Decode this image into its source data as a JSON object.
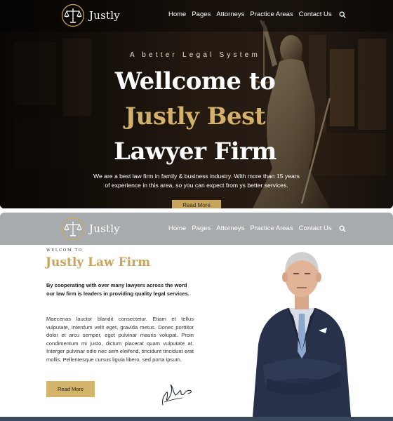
{
  "brand": {
    "name": "Justly",
    "accent": "#c9a55c",
    "logo_icon": "scales-of-justice-icon"
  },
  "nav": {
    "items": [
      "Home",
      "Pages",
      "Attorneys",
      "Practice Areas",
      "Contact Us"
    ],
    "search_icon": "search-icon"
  },
  "hero": {
    "tagline": "A better Legal System",
    "title_line1": "Wellcome to",
    "title_line2": "Justly Best",
    "title_line3": "Lawyer Firm",
    "description": "We are a best law firm in family & business industry. With more than 15 years of experience in this area, so you can expect from ys better services.",
    "button_label": "Read More",
    "title_line2_color": "#d4b16a"
  },
  "about": {
    "eyebrow": "WELCOM TO",
    "title": "Justly Law Firm",
    "lead": "By cooperating with over many lawyers across the word our law firm is leaders in providing quality legal services.",
    "body": "Maecenas lauctor blandit consectetur. Etiam et tellus vulputate, interdum velit eget, gravida metus. Donec porttitor dolor et arcu semper, eget pulvinar mauris volupat. Proin condimentum mi justo, dictum placerat quam vulputate at. Interger pulvinar odio nec sem eleifend, tincidunt tincidunt erat mollis. Pellentesque cursus ligula libero, sed porta ipsum.",
    "button_label": "Read More"
  }
}
